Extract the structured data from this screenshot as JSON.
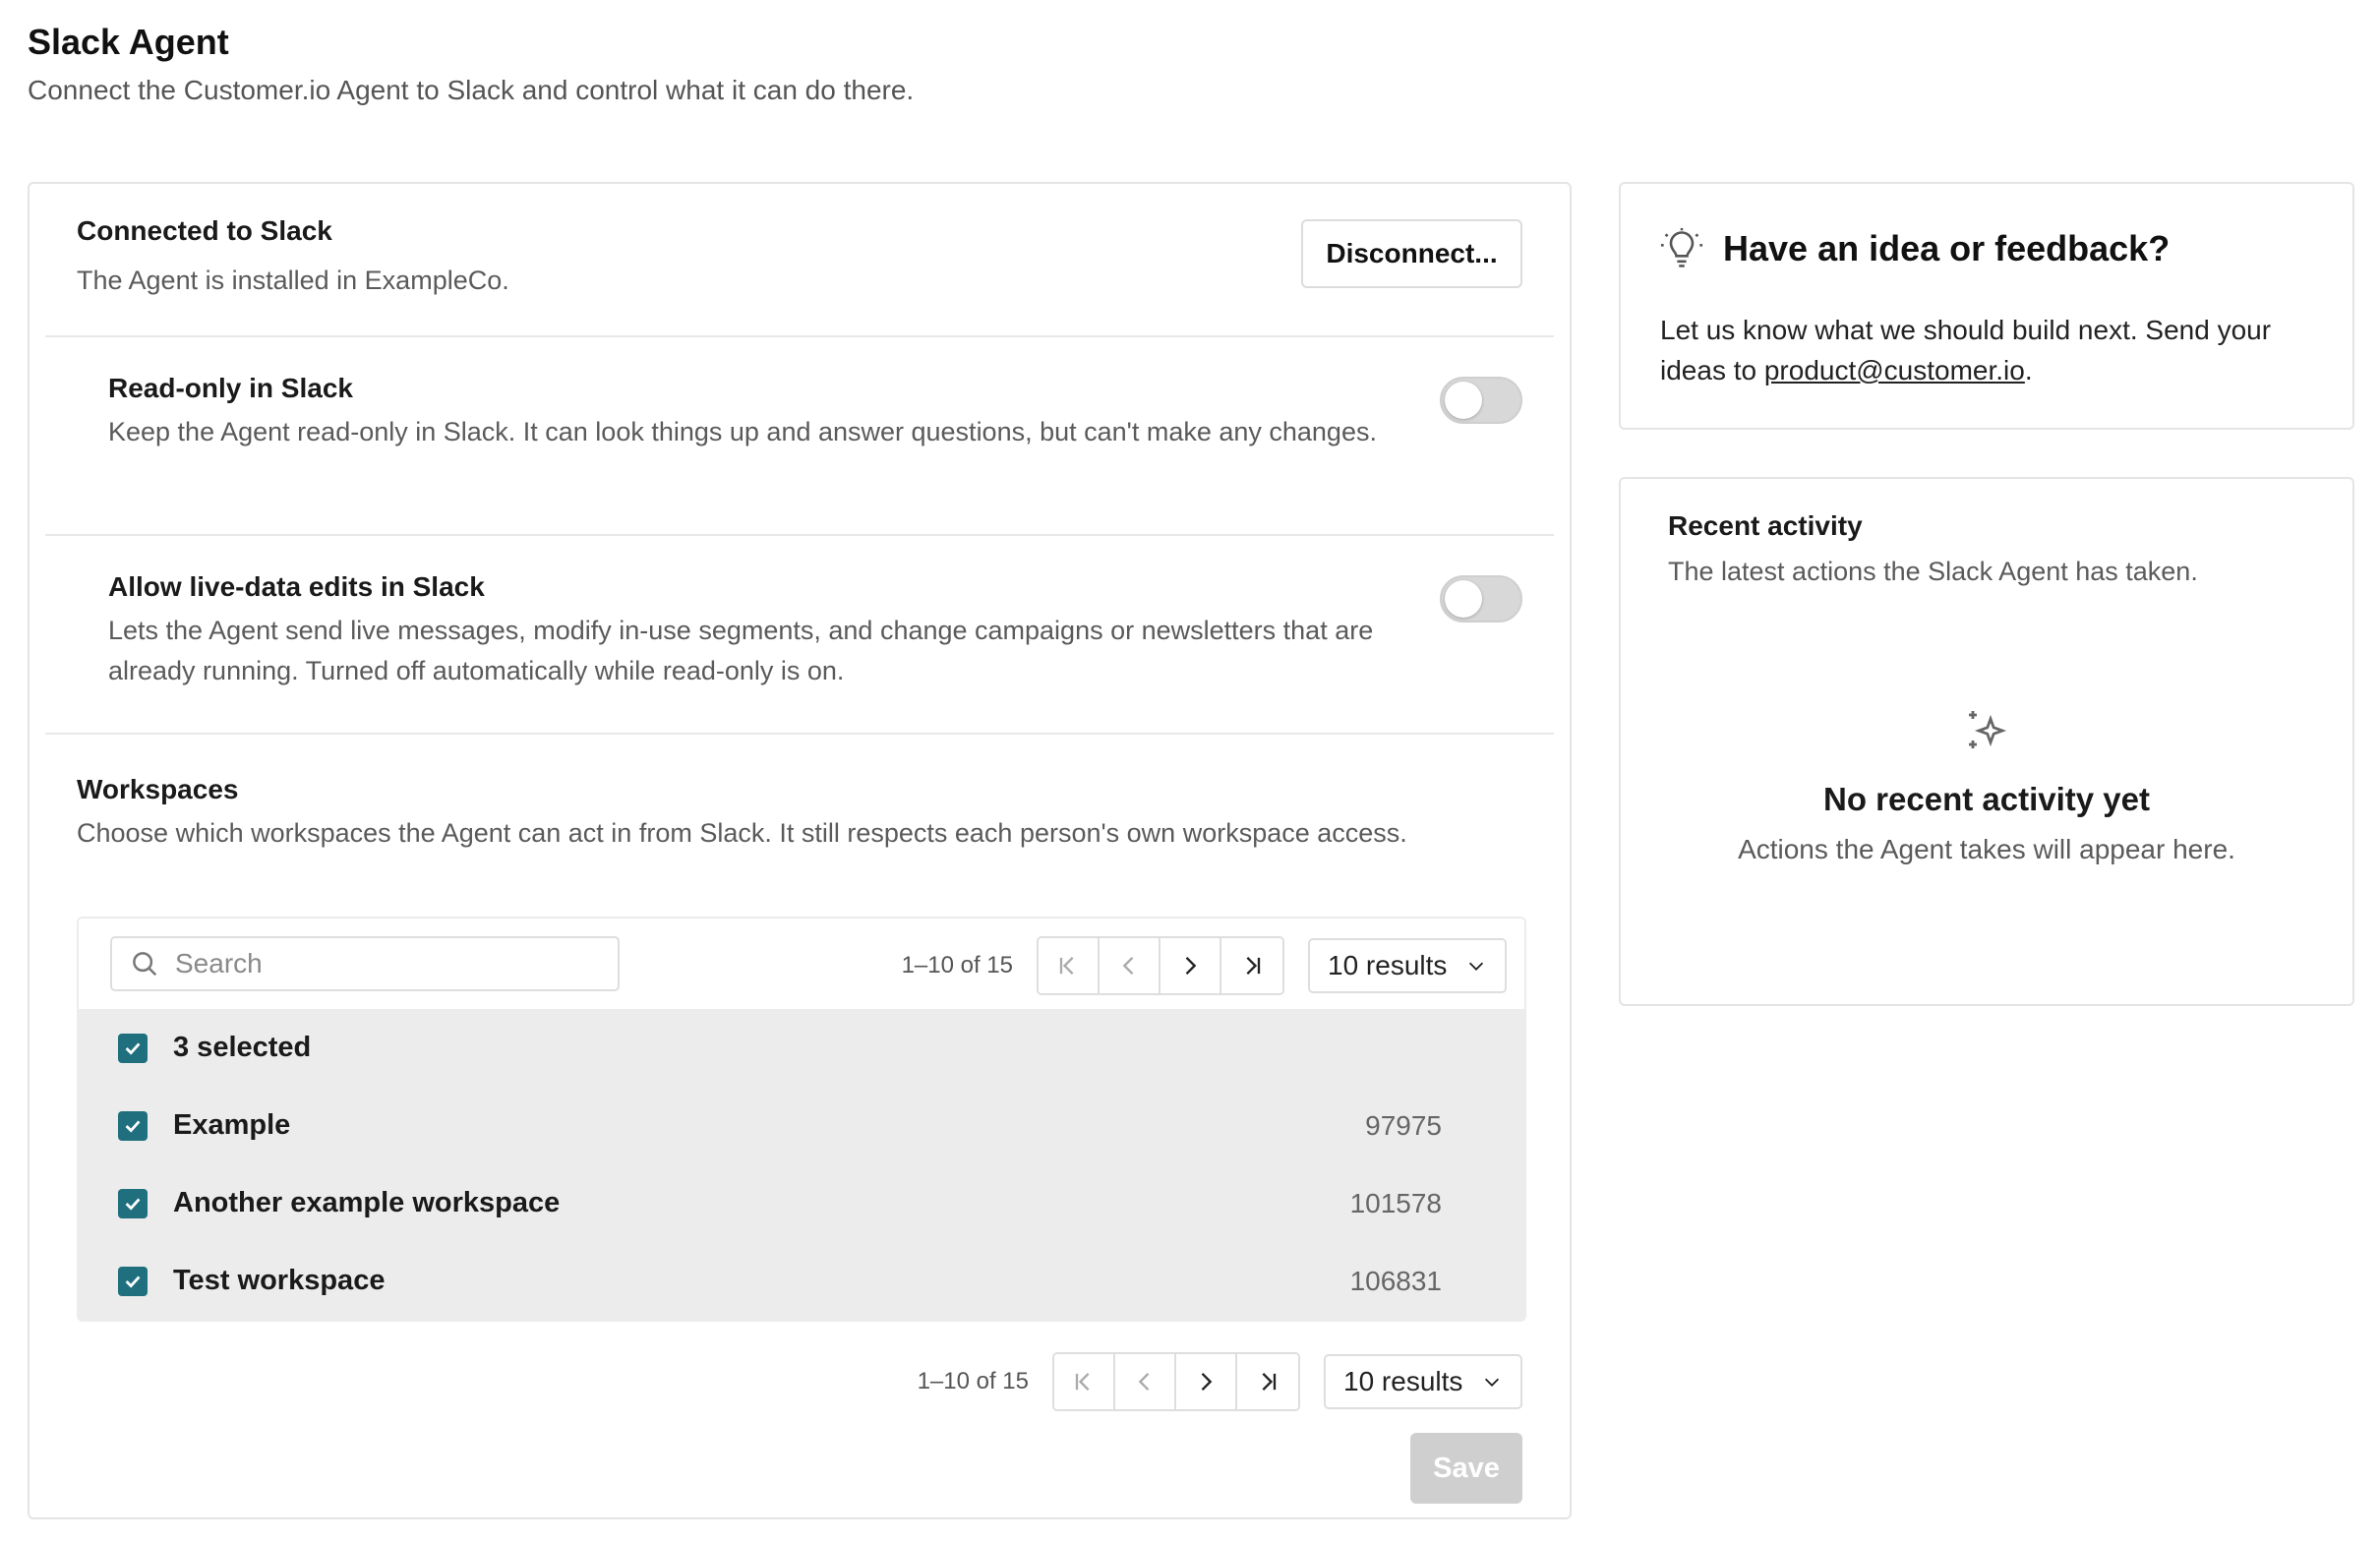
{
  "page": {
    "title": "Slack Agent",
    "subtitle": "Connect the Customer.io Agent to Slack and control what it can do there."
  },
  "connection": {
    "title": "Connected to Slack",
    "desc": "The Agent is installed in ExampleCo.",
    "disconnect_label": "Disconnect..."
  },
  "settings": {
    "read_only": {
      "title": "Read-only in Slack",
      "desc": "Keep the Agent read-only in Slack. It can look things up and answer questions, but can't make any changes.",
      "enabled": false
    },
    "live_edits": {
      "title": "Allow live-data edits in Slack",
      "desc": "Lets the Agent send live messages, modify in-use segments, and change campaigns or newsletters that are already running. Turned off automatically while read-only is on.",
      "enabled": false
    }
  },
  "workspaces": {
    "title": "Workspaces",
    "desc": "Choose which workspaces the Agent can act in from Slack. It still respects each person's own workspace access.",
    "search_placeholder": "Search",
    "pagination": {
      "range": "1–10 of 15",
      "results_label": "10 results"
    },
    "selected_label": "3 selected",
    "rows": [
      {
        "name": "Example",
        "id": "97975",
        "checked": true
      },
      {
        "name": "Another example workspace",
        "id": "101578",
        "checked": true
      },
      {
        "name": "Test workspace",
        "id": "106831",
        "checked": true
      }
    ],
    "save_label": "Save"
  },
  "feedback": {
    "title": "Have an idea or feedback?",
    "body_prefix": "Let us know what we should build next. Send your ideas to ",
    "email": "product@customer.io",
    "body_suffix": "."
  },
  "activity": {
    "title": "Recent activity",
    "desc": "The latest actions the Slack Agent has taken.",
    "empty_title": "No recent activity yet",
    "empty_desc": "Actions the Agent takes will appear here."
  },
  "colors": {
    "checkbox": "#1f6f7f",
    "save_disabled": "#cfcfcf",
    "toggle_off": "#d8d8d8"
  }
}
